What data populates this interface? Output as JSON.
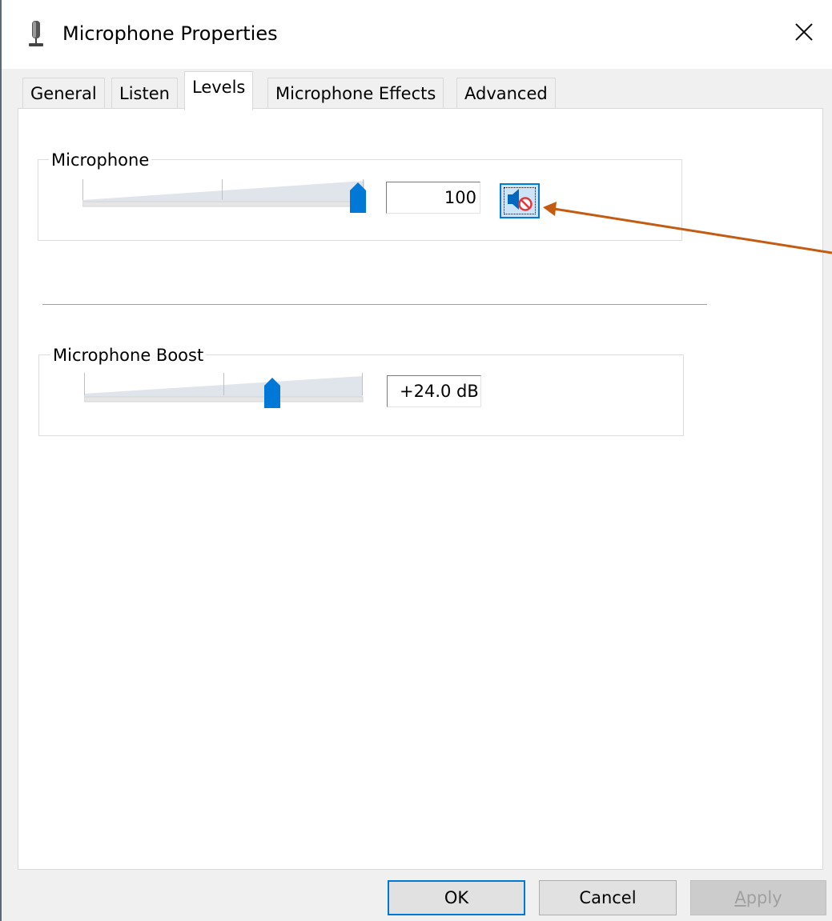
{
  "window": {
    "title": "Microphone Properties",
    "icon": "microphone-icon",
    "close_icon": "close-icon"
  },
  "tabs": [
    {
      "label": "General",
      "active": false
    },
    {
      "label": "Listen",
      "active": false
    },
    {
      "label": "Levels",
      "active": true
    },
    {
      "label": "Microphone Effects",
      "active": false
    },
    {
      "label": "Advanced",
      "active": false
    }
  ],
  "microphone": {
    "group_label": "Microphone",
    "level_value": "100",
    "slider_fraction": 1.0,
    "mute_icon": "speaker-muted-icon"
  },
  "boost": {
    "group_label": "Microphone Boost",
    "value": "+24.0 dB",
    "slider_fraction": 0.67
  },
  "buttons": {
    "ok": "OK",
    "cancel": "Cancel",
    "apply_accel": "A",
    "apply_rest": "pply"
  },
  "colors": {
    "accent": "#0078d7",
    "annotation_arrow": "#c55a11",
    "mute_badge": "#e0393e"
  }
}
